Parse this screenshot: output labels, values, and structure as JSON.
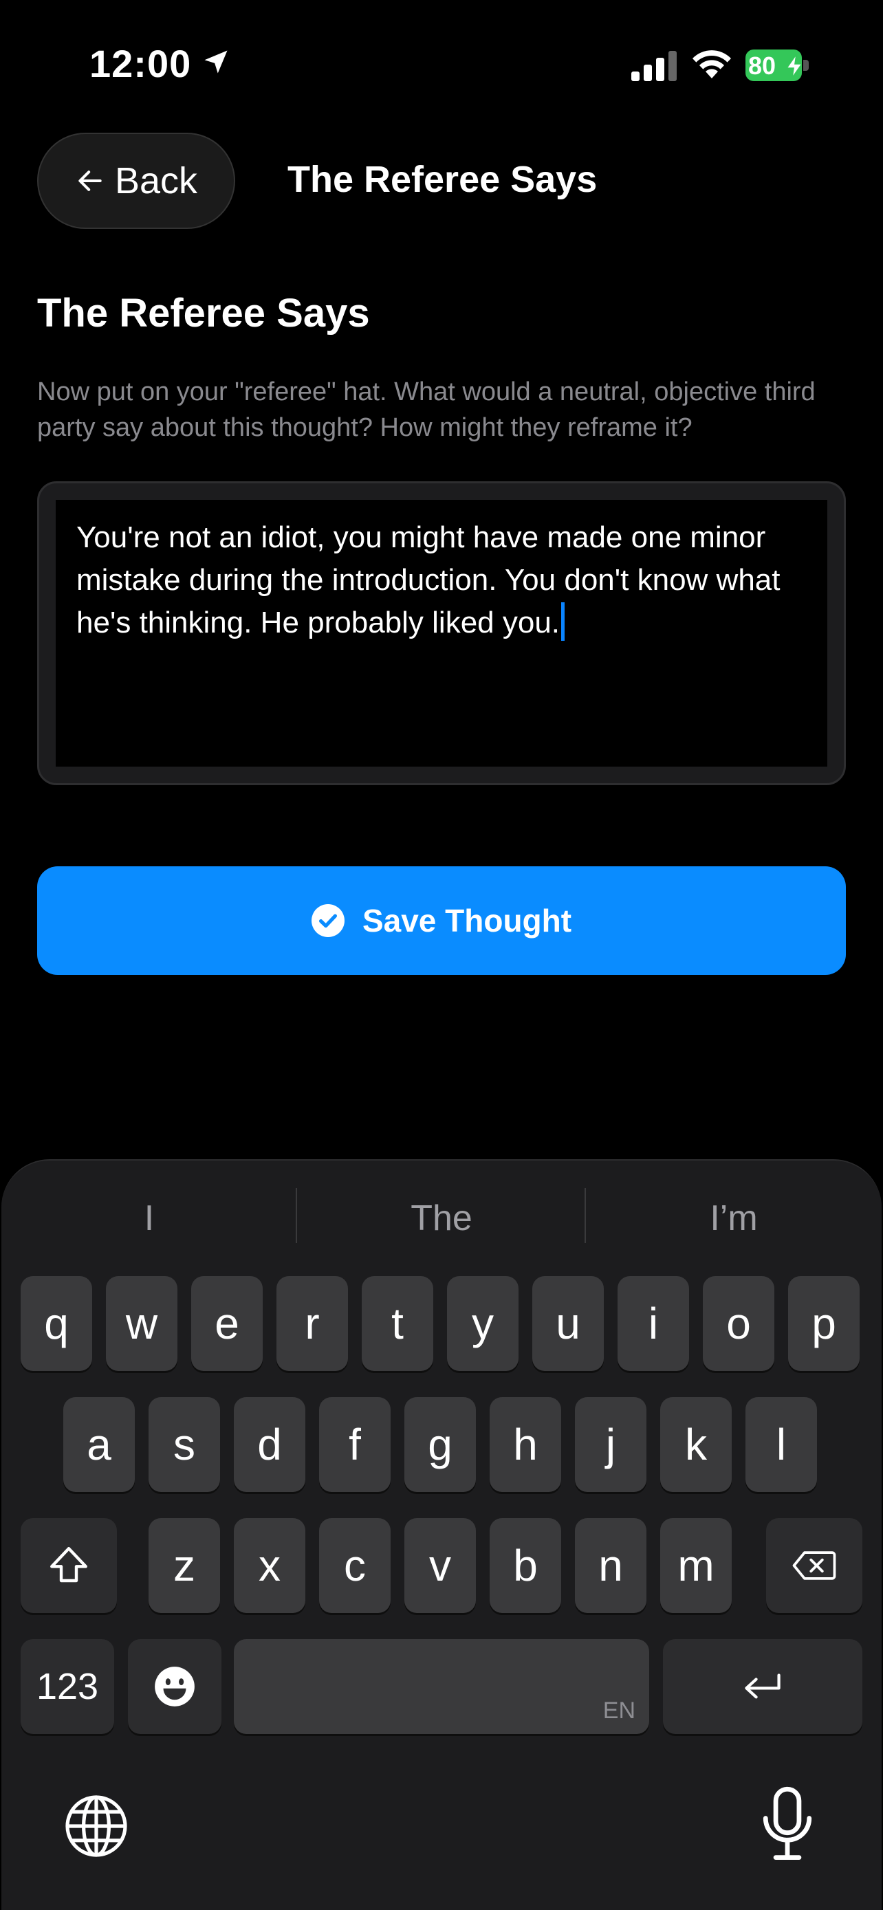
{
  "status": {
    "time": "12:00",
    "battery": "80"
  },
  "header": {
    "back_label": "Back",
    "title": "The Referee Says"
  },
  "page": {
    "title": "The Referee Says",
    "description": "Now put on your \"referee\" hat. What would a neutral, objective third party say about this thought? How might they reframe it?"
  },
  "thought_input": {
    "value": "You're not an idiot, you might have made one minor mistake during the introduction. You don't know what he's thinking. He probably liked you."
  },
  "save_button": {
    "label": "Save Thought"
  },
  "keyboard": {
    "suggestions": [
      "I",
      "The",
      "I’m"
    ],
    "row1": [
      "q",
      "w",
      "e",
      "r",
      "t",
      "y",
      "u",
      "i",
      "o",
      "p"
    ],
    "row2": [
      "a",
      "s",
      "d",
      "f",
      "g",
      "h",
      "j",
      "k",
      "l"
    ],
    "row3": [
      "z",
      "x",
      "c",
      "v",
      "b",
      "n",
      "m"
    ],
    "numbers_label": "123",
    "space_lang": "EN"
  },
  "colors": {
    "accent": "#0a8cff",
    "battery": "#34c759",
    "caret": "#0a84ff"
  }
}
